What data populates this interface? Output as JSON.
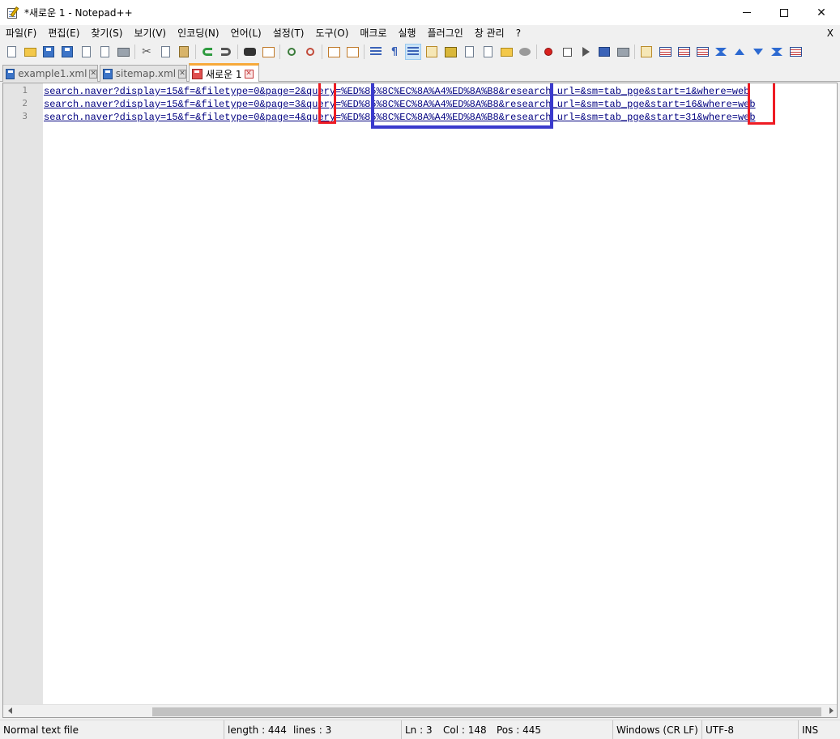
{
  "window": {
    "title": "*새로운 1 - Notepad++",
    "controls": {
      "minimize": "—",
      "maximize": "☐",
      "close": "✕"
    }
  },
  "menu": {
    "items": [
      "파일(F)",
      "편집(E)",
      "찾기(S)",
      "보기(V)",
      "인코딩(N)",
      "언어(L)",
      "설정(T)",
      "도구(O)",
      "매크로",
      "실행",
      "플러그인",
      "창 관리",
      "?"
    ],
    "close_label": "X"
  },
  "tabs": [
    {
      "label": "example1.xml",
      "close": "✕",
      "active": false
    },
    {
      "label": "sitemap.xml",
      "close": "✕",
      "active": false
    },
    {
      "label": "새로운 1",
      "close": "✕",
      "active": true
    }
  ],
  "editor": {
    "line_numbers": [
      "1",
      "2",
      "3"
    ],
    "lines": [
      "search.naver?display=15&f=&filetype=0&page=2&query=%ED%85%8C%EC%8A%A4%ED%8A%B8&research_url=&sm=tab_pge&start=1&where=web",
      "search.naver?display=15&f=&filetype=0&page=3&query=%ED%85%8C%EC%8A%A4%ED%8A%B8&research_url=&sm=tab_pge&start=16&where=web",
      "search.naver?display=15&f=&filetype=0&page=4&query=%ED%85%8C%EC%8A%A4%ED%8A%B8&research_url=&sm=tab_pge&start=31&where=web"
    ],
    "highlight_colors": {
      "red": "#ee1c24",
      "blue": "#3a3acd"
    }
  },
  "statusbar": {
    "file_type": "Normal text file",
    "length": "length : 444",
    "lines": "lines : 3",
    "ln": "Ln : 3",
    "col": "Col : 148",
    "pos": "Pos : 445",
    "eol": "Windows (CR LF)",
    "encoding": "UTF-8",
    "mode": "INS"
  }
}
